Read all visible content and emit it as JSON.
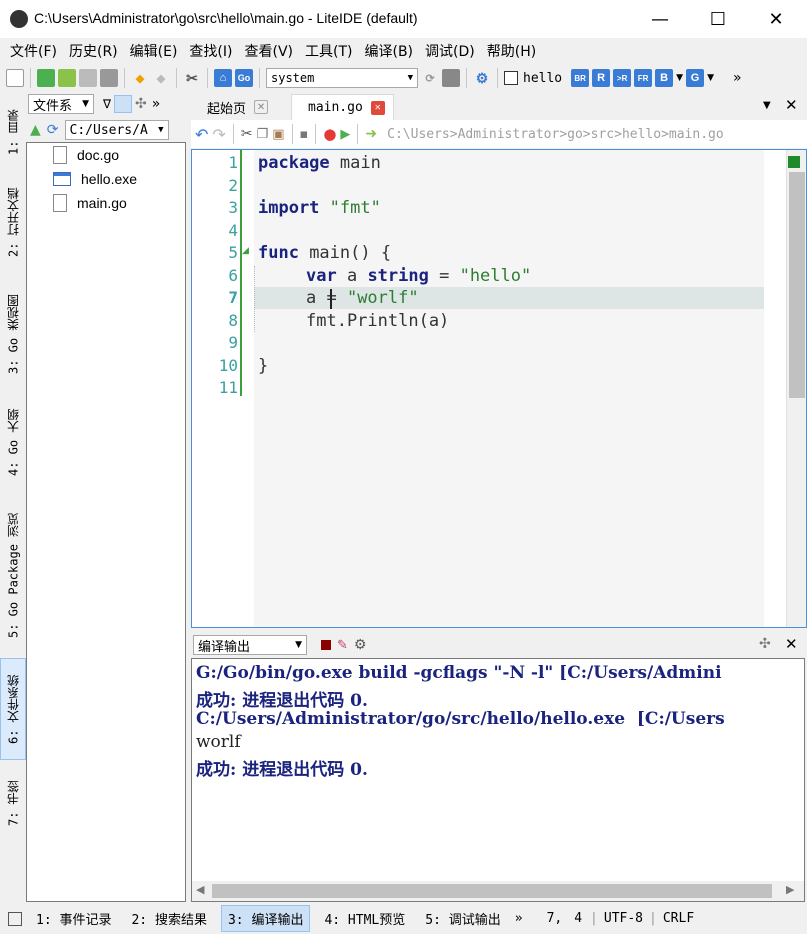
{
  "window": {
    "title": "C:\\Users\\Administrator\\go\\src\\hello\\main.go - LiteIDE (default)",
    "minimize": "—",
    "maximize": "☐",
    "close": "✕"
  },
  "menu": [
    "文件(F)",
    "历史(R)",
    "编辑(E)",
    "查找(I)",
    "查看(V)",
    "工具(T)",
    "编译(B)",
    "调试(D)",
    "帮助(H)"
  ],
  "toolbar": {
    "env_combo": "system",
    "target_label": "hello",
    "build_buttons": [
      "BR",
      "R",
      ">R",
      "FR",
      "B",
      "G"
    ],
    "overflow": "»"
  },
  "vtabs": [
    "1: 目录",
    "2: 打开文档",
    "3: Go 类视图",
    "4: Go 大纲",
    "5: Go Package 浏览",
    "6: 文件系统",
    "7: 书签"
  ],
  "leftpanel": {
    "combo": "文件系",
    "path_combo": "C:/Users/A",
    "overflow": "»",
    "files": [
      {
        "name": "doc.go",
        "icon": "go-file-icon"
      },
      {
        "name": "hello.exe",
        "icon": "exe-file-icon"
      },
      {
        "name": "main.go",
        "icon": "go-file-icon"
      }
    ]
  },
  "editor": {
    "tabs": [
      {
        "label": "起始页",
        "active": false
      },
      {
        "label": "main.go",
        "active": true
      }
    ],
    "path": "C:\\Users>Administrator>go>src>hello>main.go",
    "line_numbers": [
      "1",
      "2",
      "3",
      "4",
      "5",
      "6",
      "7",
      "8",
      "9",
      "10",
      "11"
    ],
    "current_line": 7,
    "code": {
      "l1_kw": "package",
      "l1_rest": " main",
      "l3_kw": "import",
      "l3_str": "\"fmt\"",
      "l5_kw": "func",
      "l5_rest": " main() {",
      "l6_kw": "var",
      "l6_a": " a ",
      "l6_kw2": "string",
      "l6_eq": " = ",
      "l6_str": "\"hello\"",
      "l7_rest": "a = ",
      "l7_str": "\"worlf\"",
      "l8_rest": "fmt.Println(a)",
      "l10_rest": "}"
    }
  },
  "output": {
    "combo": "编译输出",
    "lines": [
      "G:/Go/bin/go.exe build -gcflags \"-N -l\" [C:/Users/Admini",
      "成功: 进程退出代码 0.",
      "C:/Users/Administrator/go/src/hello/hello.exe  [C:/Users",
      "worlf",
      "成功: 进程退出代码 0."
    ]
  },
  "statusbar": {
    "items": [
      "1: 事件记录",
      "2: 搜索结果",
      "3: 编译输出",
      "4: HTML预览",
      "5: 调试输出"
    ],
    "active_index": 2,
    "overflow": "»",
    "line": "7",
    "col": "4",
    "encoding": "UTF-8",
    "eol": "CRLF"
  },
  "colors": {
    "keyword": "#1a237e",
    "string": "#2e7d32",
    "line_number": "#3aa0a0",
    "output_text": "#1a237e",
    "current_line": "#dde5e5",
    "editor_border": "#4a90d9"
  }
}
